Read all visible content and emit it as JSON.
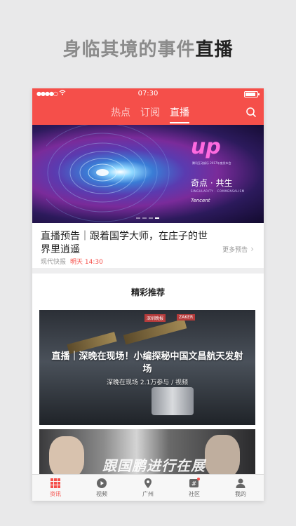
{
  "headline": {
    "normal": "身临其境的事件",
    "strong": "直播"
  },
  "status_bar": {
    "signal": "●●●●○",
    "time": "07:30"
  },
  "nav": {
    "tabs": [
      {
        "label": "热点",
        "active": false
      },
      {
        "label": "订阅",
        "active": false
      },
      {
        "label": "直播",
        "active": true
      }
    ]
  },
  "banner": {
    "logo": "up",
    "subtitle": "腾讯互动娱乐 2017年度发布会",
    "title": "奇点 · 共生",
    "title_en": "SINGULARITY · COMMENSALISM",
    "brand": "Tencent",
    "page_count": 4,
    "active_page": 4
  },
  "live_preview": {
    "title": "直播预告｜跟着国学大师，在庄子的世界里逍遥",
    "source": "现代快报",
    "time": "明天 14:30",
    "more": "更多预告"
  },
  "section": {
    "title": "精彩推荐"
  },
  "cards": [
    {
      "title": "直播｜深晚在现场！小编探秘中国文昌航天发射场",
      "meta": "深晚在现场  2.1万参与 / 视频",
      "tag1": "深圳晚报",
      "tag2": "ZAKER"
    },
    {
      "title": "跟国鹏进行在展"
    }
  ],
  "tabbar": [
    {
      "label": "资讯",
      "icon": "grid-icon",
      "active": true
    },
    {
      "label": "视频",
      "icon": "play-icon",
      "active": false
    },
    {
      "label": "广州",
      "icon": "location-pin-icon",
      "active": false
    },
    {
      "label": "社区",
      "icon": "hashtag-icon",
      "active": false
    },
    {
      "label": "我的",
      "icon": "person-icon",
      "active": false
    }
  ],
  "colors": {
    "brand": "#f54f4a"
  }
}
